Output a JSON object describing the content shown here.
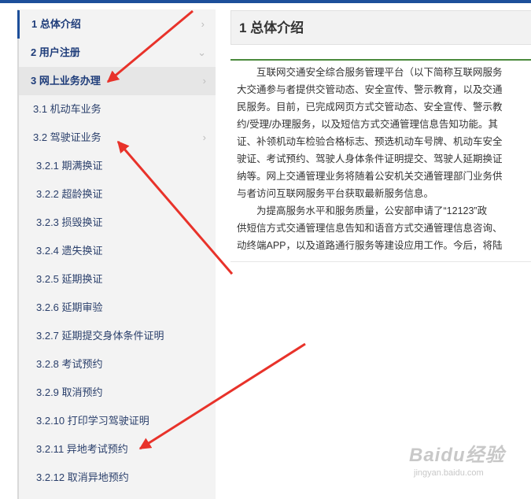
{
  "sidebar": {
    "items": [
      {
        "label": "1 总体介绍",
        "level": 1
      },
      {
        "label": "2 用户注册",
        "level": 1
      },
      {
        "label": "3 网上业务办理",
        "level": 1
      },
      {
        "label": "3.1 机动车业务",
        "level": 2
      },
      {
        "label": "3.2 驾驶证业务",
        "level": 2
      },
      {
        "label": "3.2.1 期满换证",
        "level": 3
      },
      {
        "label": "3.2.2 超龄换证",
        "level": 3
      },
      {
        "label": "3.2.3 损毁换证",
        "level": 3
      },
      {
        "label": "3.2.4 遗失换证",
        "level": 3
      },
      {
        "label": "3.2.5 延期换证",
        "level": 3
      },
      {
        "label": "3.2.6 延期审验",
        "level": 3
      },
      {
        "label": "3.2.7 延期提交身体条件证明",
        "level": 3
      },
      {
        "label": "3.2.8 考试预约",
        "level": 3
      },
      {
        "label": "3.2.9 取消预约",
        "level": 3
      },
      {
        "label": "3.2.10 打印学习驾驶证明",
        "level": 3
      },
      {
        "label": "3.2.11 异地考试预约",
        "level": 3
      },
      {
        "label": "3.2.12 取消异地预约",
        "level": 3
      }
    ]
  },
  "main": {
    "title": "1 总体介绍",
    "paragraph1": [
      "　　互联网交通安全综合服务管理平台（以下简称互联网服务",
      "大交通参与者提供交管动态、安全宣传、警示教育，以及交通",
      "民服务。目前，已完成网页方式交管动态、安全宣传、警示教",
      "约/受理/办理服务，以及短信方式交通管理信息告知功能。其",
      "证、补领机动车检验合格标志、预选机动车号牌、机动车安全",
      "驶证、考试预约、驾驶人身体条件证明提交、驾驶人延期换证",
      "纳等。网上交通管理业务将随着公安机关交通管理部门业务供",
      "与者访问互联网服务平台获取最新服务信息。"
    ],
    "paragraph2": [
      "　　为提高服务水平和服务质量，公安部申请了“12123”政",
      "供短信方式交通管理信息告知和语音方式交通管理信息咨询、",
      "动终端APP，以及道路通行服务等建设应用工作。今后，将陆"
    ]
  },
  "watermark": {
    "brand": "Baidu经验",
    "url": "jingyan.baidu.com"
  },
  "colors": {
    "accent": "#1d4f9a",
    "arrow": "#e8322a",
    "divider": "#4a8a3c"
  }
}
